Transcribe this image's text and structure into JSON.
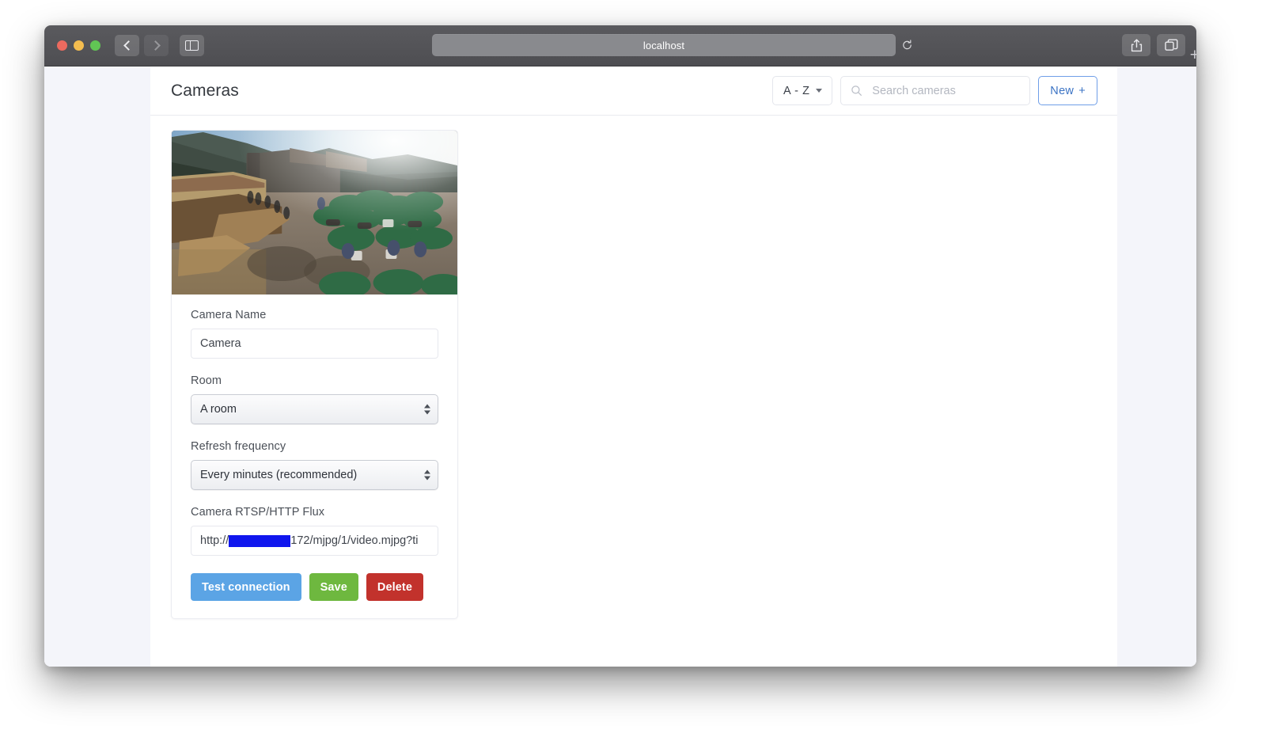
{
  "browser": {
    "address_value": "localhost",
    "back_icon": "chevron-left-icon",
    "forward_icon": "chevron-right-icon",
    "sidebar_icon": "sidebar-toggle-icon",
    "reload_icon": "reload-icon",
    "share_icon": "share-icon",
    "tabs_icon": "tab-overview-icon",
    "new_tab_label": "+"
  },
  "header": {
    "title": "Cameras",
    "sort_label": "A - Z",
    "sort_caret_icon": "chevron-down-icon",
    "search_icon": "search-icon",
    "search_value": "",
    "search_placeholder": "Search cameras",
    "new_label": "New",
    "new_plus": "+"
  },
  "camera_card": {
    "thumbnail_alt": "outdoor patio with green umbrellas",
    "fields": {
      "name_label": "Camera Name",
      "name_value": "Camera",
      "room_label": "Room",
      "room_value": "A room",
      "refresh_label": "Refresh frequency",
      "refresh_value": "Every minutes (recommended)",
      "flux_label": "Camera RTSP/HTTP Flux",
      "flux_prefix": "http://",
      "flux_suffix": "172/mjpg/1/video.mjpg?ti"
    },
    "buttons": {
      "test_label": "Test connection",
      "save_label": "Save",
      "delete_label": "Delete"
    }
  },
  "colors": {
    "test_button": "#5ba4e5",
    "save_button": "#6eb83f",
    "delete_button": "#c2322c",
    "accent_blue": "#3b73c4",
    "redaction": "#1016ee",
    "page_background": "#f4f5fa"
  }
}
